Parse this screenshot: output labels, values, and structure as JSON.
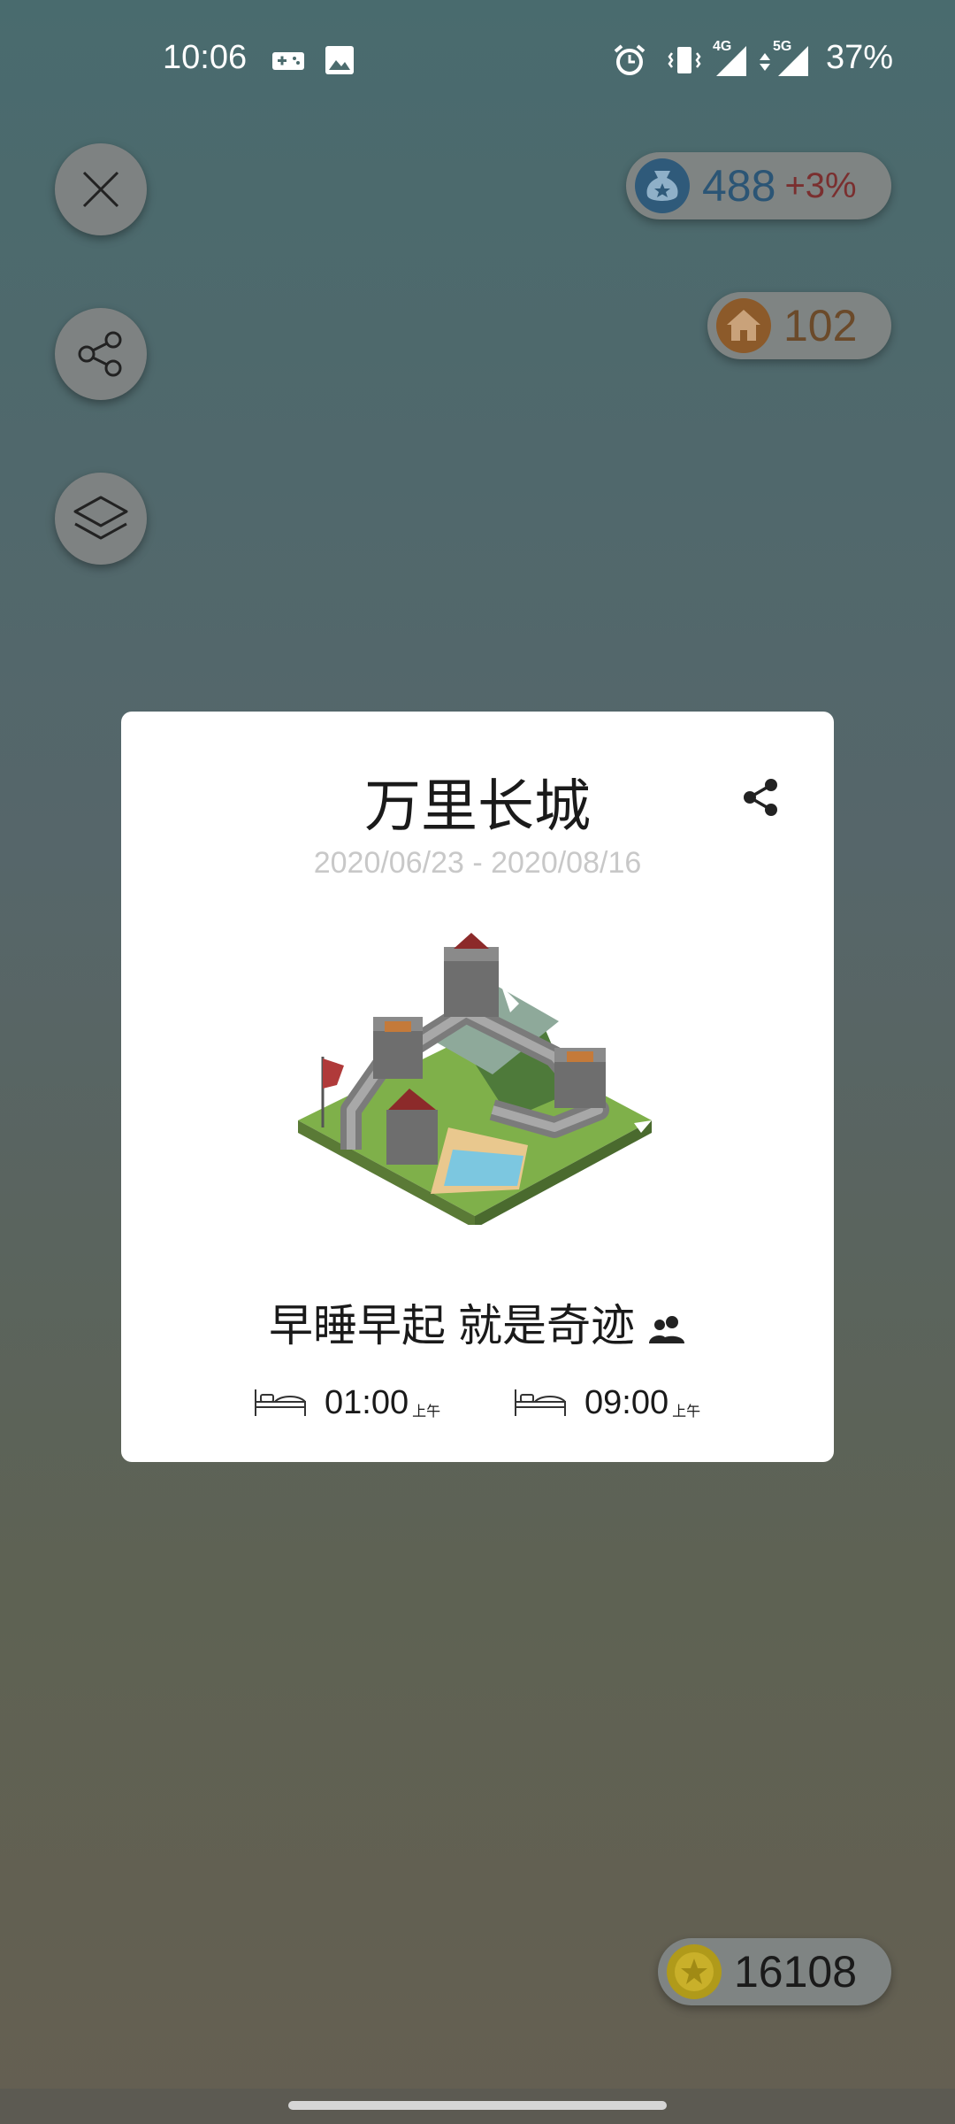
{
  "status_bar": {
    "time": "10:06",
    "battery": "37%",
    "network_1": "4G",
    "network_2": "5G",
    "icons": [
      "gamepad-icon",
      "image-icon",
      "alarm-icon",
      "vibrate-icon",
      "signal-icon",
      "signal-icon",
      "battery-icon"
    ]
  },
  "left_actions": {
    "close_icon": "close-icon",
    "share_icon": "share-icon",
    "layers_icon": "layers-icon"
  },
  "stats": {
    "money": "488",
    "money_change": "+3%",
    "houses": "102",
    "coins": "16108"
  },
  "card": {
    "title": "万里长城",
    "dates": "2020/06/23 - 2020/08/16",
    "slogan": "早睡早起 就是奇迹",
    "bedtime": "01:00",
    "bedtime_ampm": "上午",
    "wakeup": "09:00",
    "wakeup_ampm": "上午"
  },
  "colors": {
    "card_bg": "#ffffff",
    "money_icon": "#2f5a7a",
    "money_change": "#7a2f2f",
    "house_icon": "#8c5a2a",
    "coin_icon": "#b09a1a"
  }
}
